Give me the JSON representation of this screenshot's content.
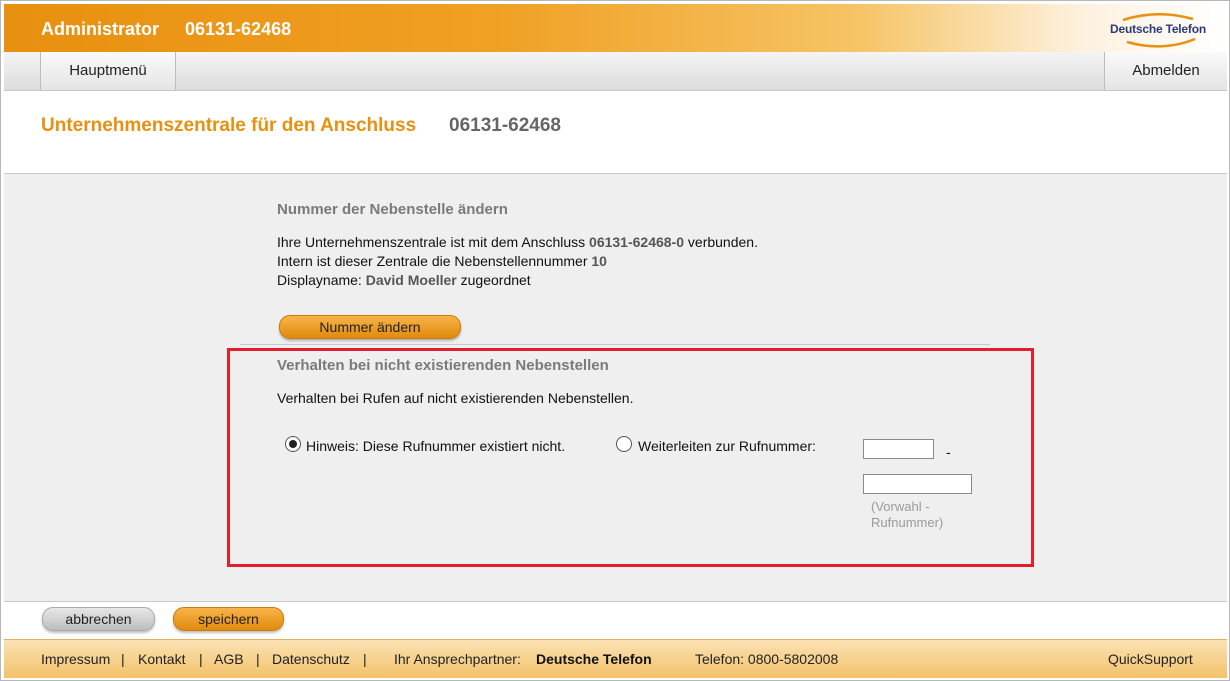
{
  "header": {
    "role": "Administrator",
    "number": "06131-62468",
    "logo_text": "Deutsche Telefon"
  },
  "nav": {
    "home_label": "Hauptmenü",
    "logout_label": "Abmelden"
  },
  "page": {
    "title": "Unternehmenszentrale für den Anschluss",
    "title_number": "06131-62468"
  },
  "extension_section": {
    "title": "Nummer der Nebenstelle ändern",
    "line1_prefix": "Ihre Unternehmenszentrale ist mit dem Anschluss",
    "line1_number": "06131-62468-0",
    "line1_suffix": "verbunden.",
    "line2_prefix": "Intern ist dieser Zentrale die Nebenstellennummer",
    "line2_value": "10",
    "line3_prefix": "Displayname:",
    "line3_value": "David Moeller",
    "line3_suffix": "zugeordnet",
    "change_button": "Nummer ändern"
  },
  "behavior_section": {
    "title": "Verhalten bei nicht existierenden Nebenstellen",
    "description": "Verhalten bei Rufen auf nicht existierenden Nebenstellen.",
    "option_notice": "Hinweis: Diese Rufnummer existiert nicht.",
    "option_forward": "Weiterleiten zur Rufnummer:",
    "selected": "notice",
    "area_code_value": "",
    "separator": "-",
    "number_value": "",
    "hint_line1": "(Vorwahl -",
    "hint_line2": "Rufnummer)"
  },
  "actions": {
    "cancel": "abbrechen",
    "save": "speichern"
  },
  "footer": {
    "impressum": "Impressum",
    "kontakt": "Kontakt",
    "agb": "AGB",
    "datenschutz": "Datenschutz",
    "separator": "|",
    "partner_label": "Ihr Ansprechpartner:",
    "partner_name": "Deutsche Telefon",
    "phone": "Telefon: 0800-5802008",
    "quicksupport": "QuickSupport"
  },
  "colors": {
    "accent": "#e8900f",
    "highlight": "#e0202c",
    "logo_blue": "#2b3a7a"
  }
}
